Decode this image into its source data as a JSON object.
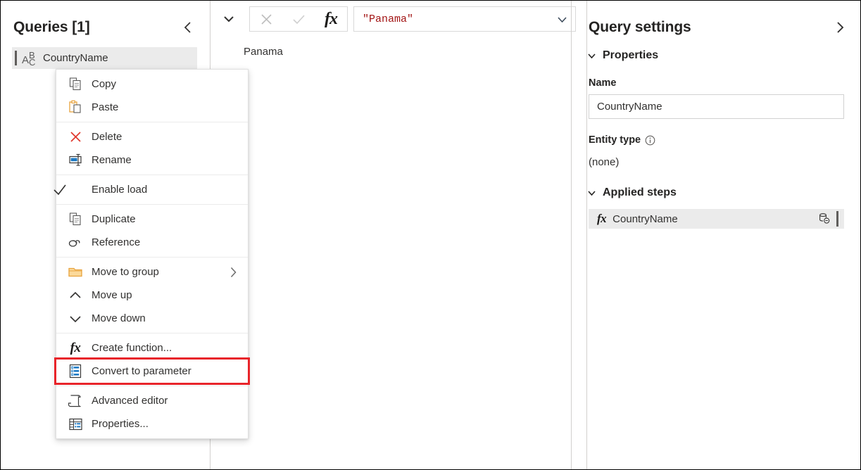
{
  "queries_pane": {
    "title": "Queries [1]",
    "collapse_icon": "chevron-left-icon",
    "items": [
      {
        "label": "CountryName",
        "type_icon": "abc-text-type-icon",
        "glyph_a": "A",
        "glyph_b": "B",
        "glyph_c": "C"
      }
    ]
  },
  "formula_bar": {
    "expander_icon": "chevron-down-icon",
    "cancel_icon": "close-x-icon",
    "accept_icon": "checkmark-icon",
    "fx_label": "fx",
    "value": "\"Panama\"",
    "dropdown_icon": "chevron-down-icon"
  },
  "preview": {
    "value": "Panama"
  },
  "query_settings": {
    "title": "Query settings",
    "expand_icon": "chevron-right-icon",
    "properties_section": {
      "label": "Properties",
      "expanded": true,
      "chevron_icon": "chevron-down-icon",
      "name_label": "Name",
      "name_value": "CountryName",
      "name_placeholder": "Name",
      "entity_type_label": "Entity type",
      "entity_type_info_icon": "info-icon",
      "entity_type_value": "(none)"
    },
    "applied_steps_section": {
      "label": "Applied steps",
      "expanded": true,
      "chevron_icon": "chevron-down-icon",
      "steps": [
        {
          "name": "CountryName",
          "icon": "fx",
          "folding_icon": "database-no-folding-icon"
        }
      ]
    }
  },
  "context_menu": {
    "items": [
      {
        "label": "Copy",
        "icon": "copy-icon",
        "separator_after": false
      },
      {
        "label": "Paste",
        "icon": "paste-icon",
        "separator_after": true
      },
      {
        "label": "Delete",
        "icon": "delete-x-icon",
        "separator_after": false
      },
      {
        "label": "Rename",
        "icon": "rename-icon",
        "separator_after": true
      },
      {
        "label": "Enable load",
        "icon": "checkmark-icon",
        "separator_after": true
      },
      {
        "label": "Duplicate",
        "icon": "duplicate-icon",
        "separator_after": false
      },
      {
        "label": "Reference",
        "icon": "reference-link-icon",
        "separator_after": true
      },
      {
        "label": "Move to group",
        "icon": "folder-icon",
        "submenu_icon": "chevron-right-icon",
        "separator_after": false
      },
      {
        "label": "Move up",
        "icon": "chevron-up-icon",
        "separator_after": false
      },
      {
        "label": "Move down",
        "icon": "chevron-down-icon",
        "separator_after": true
      },
      {
        "label": "Create function...",
        "icon": "fx-icon",
        "separator_after": false
      },
      {
        "label": "Convert to parameter",
        "icon": "parameter-list-icon",
        "highlighted": true,
        "separator_after": true
      },
      {
        "label": "Advanced editor",
        "icon": "advanced-editor-icon",
        "separator_after": false
      },
      {
        "label": "Properties...",
        "icon": "table-properties-icon",
        "separator_after": false
      }
    ]
  },
  "colors": {
    "highlight_red": "#e8242a",
    "formula_string": "#a31515",
    "selection_grey": "#ebebeb",
    "accent_orange": "#f2a83c",
    "icon_blue": "#1e7ac4",
    "delete_red": "#d83b01"
  }
}
